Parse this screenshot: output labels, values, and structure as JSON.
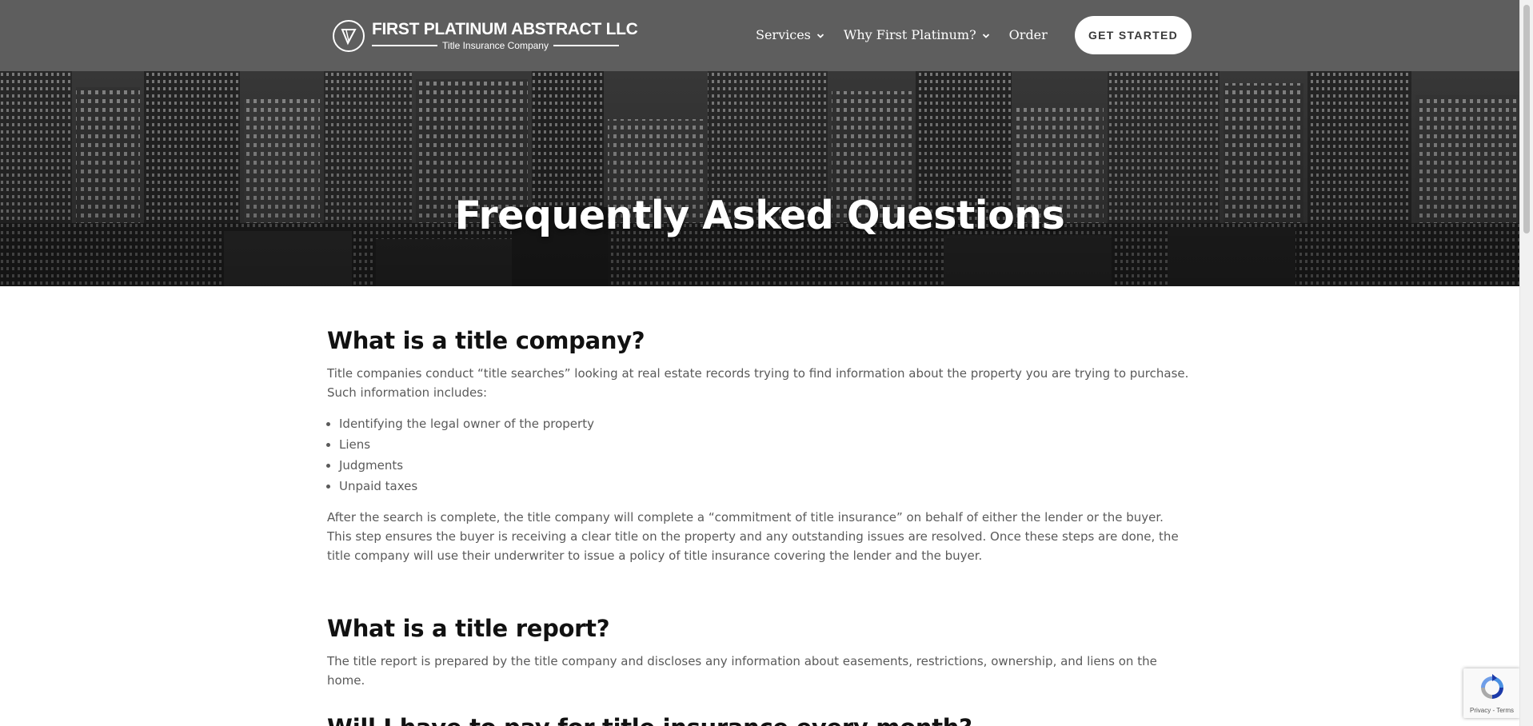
{
  "colors": {
    "header_bg": "#5e5e5e",
    "hero_text": "#ffffff",
    "heading": "#111111",
    "body_text": "#5a5a5a",
    "cta_bg": "#ffffff",
    "cta_text": "#3a3a3a"
  },
  "header": {
    "logo_name": "FIRST PLATINUM ABSTRACT LLC",
    "logo_tagline": "Title Insurance Company",
    "logo_icon": "platinum-v-circle-icon",
    "nav": [
      {
        "label": "Services",
        "icon": "chevron-down-icon"
      },
      {
        "label": "Why First Platinum?",
        "icon": "chevron-down-icon"
      },
      {
        "label": "Order"
      }
    ],
    "cta_label": "GET STARTED"
  },
  "hero": {
    "title": "Frequently Asked Questions"
  },
  "faqs": [
    {
      "question": "What is a title company?",
      "answer_lead": "Title companies conduct “title searches” looking at real estate records trying to find information about the property you are trying to purchase. Such information includes:",
      "list": [
        "Identifying the legal owner of the property",
        "Liens",
        "Judgments",
        "Unpaid taxes"
      ],
      "answer_after": "After the search is complete, the title company will complete a “commitment of title insurance” on behalf of either the lender or the buyer. This step ensures the buyer is receiving a clear title on the property and any outstanding issues are resolved. Once these steps are done, the title company will use their underwriter to issue a policy of title insurance covering the lender and the buyer."
    },
    {
      "question": "What is a title report?",
      "answer": "The title report is prepared by the title company and discloses any information about easements, restrictions, ownership, and liens on the home."
    },
    {
      "question": "Will I have to pay for title insurance every month?"
    }
  ],
  "recaptcha": {
    "icon": "recaptcha-icon",
    "privacy": "Privacy",
    "separator": " - ",
    "terms": "Terms"
  }
}
